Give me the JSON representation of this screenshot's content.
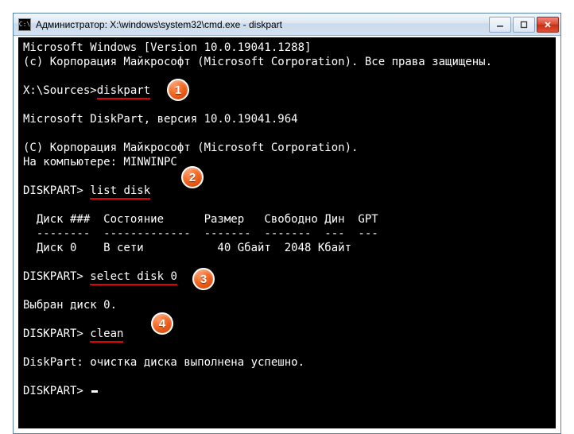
{
  "window": {
    "title": "Администратор: X:\\windows\\system32\\cmd.exe - diskpart",
    "icon_glyph": "C:\\"
  },
  "controls": {
    "minimize": "—",
    "maximize": "□",
    "close": "✕"
  },
  "terminal": {
    "line1": "Microsoft Windows [Version 10.0.19041.1288]",
    "line2": "(c) Корпорация Майкрософт (Microsoft Corporation). Все права защищены.",
    "prompt1_prefix": "X:\\Sources>",
    "cmd1": "diskpart",
    "diskpart_ver": "Microsoft DiskPart, версия 10.0.19041.964",
    "copyright": "(C) Корпорация Майкрософт (Microsoft Corporation).",
    "computer": "На компьютере: MINWINPC",
    "prompt2_prefix": "DISKPART> ",
    "cmd2": "list disk",
    "table_header": "  Диск ###  Состояние      Размер   Свободно Дин  GPT",
    "table_divider": "  --------  -------------  -------  -------  ---  ---",
    "table_row1": "  Диск 0    В сети           40 Gбайт  2048 Кбайт",
    "cmd3": "select disk 0",
    "selected_msg": "Выбран диск 0.",
    "cmd4": "clean",
    "clean_msg": "DiskPart: очистка диска выполнена успешно.",
    "final_prompt": "DISKPART> "
  },
  "badges": {
    "b1": "1",
    "b2": "2",
    "b3": "3",
    "b4": "4"
  }
}
